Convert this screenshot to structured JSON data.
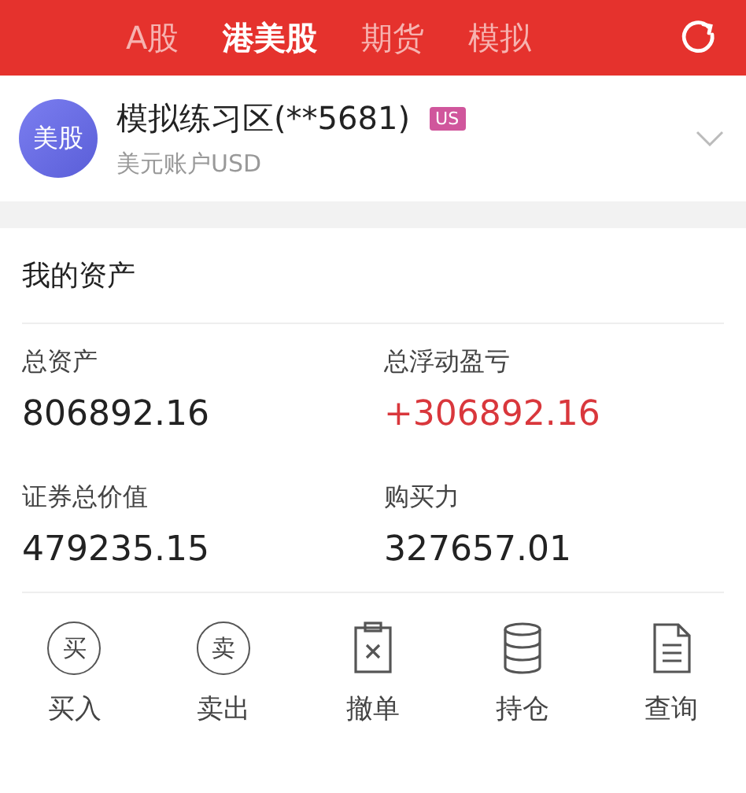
{
  "tabs": [
    {
      "label": "A股",
      "selected": false
    },
    {
      "label": "港美股",
      "selected": true
    },
    {
      "label": "期货",
      "selected": false
    },
    {
      "label": "模拟",
      "selected": false
    }
  ],
  "account": {
    "avatar": "美股",
    "title": "模拟练习区(**5681)",
    "badge": "US",
    "subtitle": "美元账户USD"
  },
  "assets": {
    "title": "我的资产",
    "stats": [
      {
        "label": "总资产",
        "value": "806892.16",
        "kind": "plain"
      },
      {
        "label": "总浮动盈亏",
        "value": "+306892.16",
        "kind": "gain"
      },
      {
        "label": "证券总价值",
        "value": "479235.15",
        "kind": "plain"
      },
      {
        "label": "购买力",
        "value": "327657.01",
        "kind": "plain"
      }
    ]
  },
  "actions": [
    {
      "label": "买入",
      "kind": "circle",
      "glyph": "买"
    },
    {
      "label": "卖出",
      "kind": "circle",
      "glyph": "卖"
    },
    {
      "label": "撤单",
      "kind": "cancel"
    },
    {
      "label": "持仓",
      "kind": "stack"
    },
    {
      "label": "查询",
      "kind": "doc"
    }
  ]
}
